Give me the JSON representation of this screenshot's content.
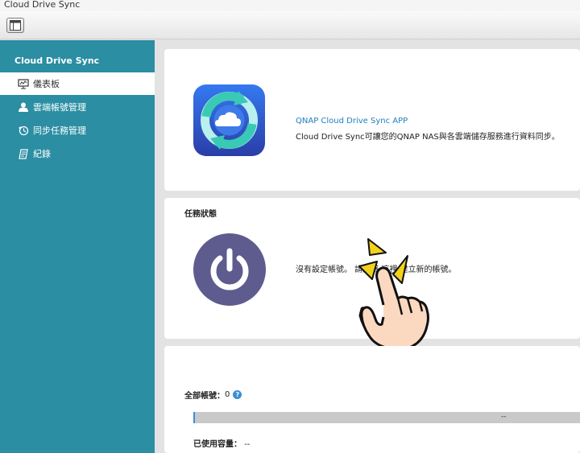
{
  "window": {
    "title": "Cloud Drive Sync"
  },
  "sidebar": {
    "title": "Cloud Drive Sync",
    "items": [
      {
        "label": "儀表板",
        "icon": "dashboard-icon",
        "active": true
      },
      {
        "label": "雲端帳號管理",
        "icon": "user-icon",
        "active": false
      },
      {
        "label": "同步任務管理",
        "icon": "history-icon",
        "active": false
      },
      {
        "label": "紀錄",
        "icon": "log-icon",
        "active": false
      }
    ]
  },
  "app_info": {
    "name": "QNAP Cloud Drive Sync APP",
    "description": "Cloud Drive Sync可讓您的QNAP NAS與各雲端儲存服務進行資料同步。"
  },
  "task_status": {
    "title": "任務狀態",
    "message_before": "沒有設定帳號。 請點擊 ",
    "link": "這裡",
    "message_after": " 建立新的帳號。"
  },
  "accounts": {
    "total_label": "全部帳號：",
    "total_value": "0",
    "bar_value": "--",
    "used_label": "已使用容量：",
    "used_value": "--"
  },
  "colors": {
    "sidebar": "#2b8ea3",
    "accent": "#1f7fbf",
    "power_bg": "#5e5b8e",
    "pointer_yellow": "#f2d21b",
    "hand_skin": "#fbd9c1"
  }
}
